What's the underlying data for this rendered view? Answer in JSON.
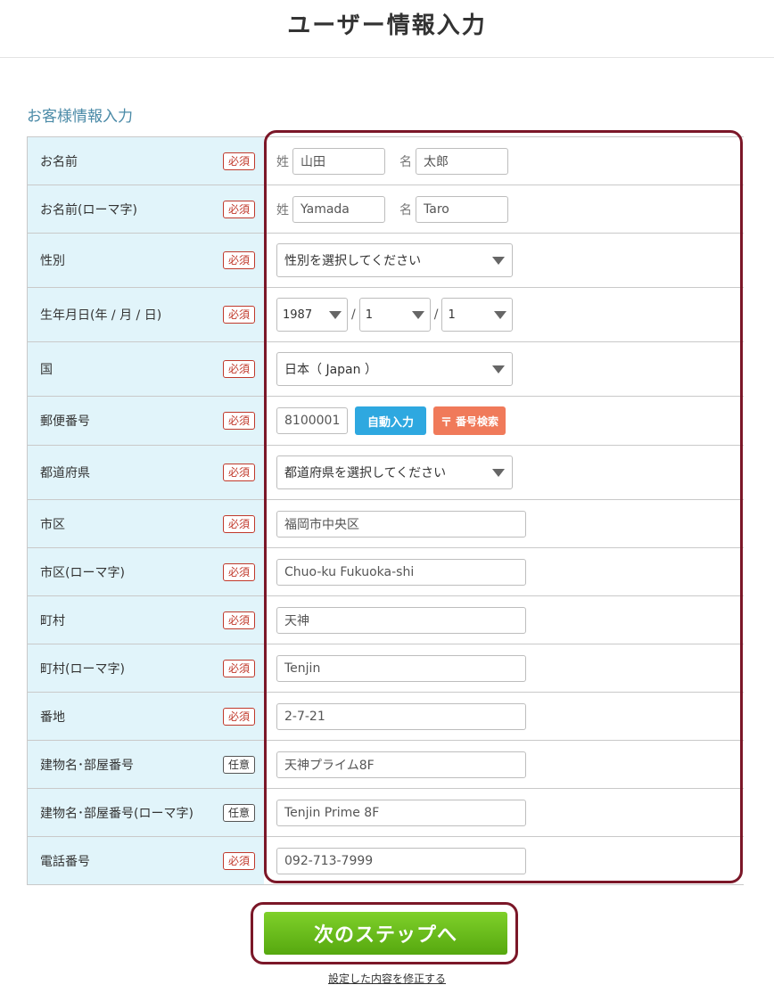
{
  "header": {
    "title": "ユーザー情報入力"
  },
  "section": {
    "title": "お客様情報入力"
  },
  "badges": {
    "required": "必須",
    "optional": "任意"
  },
  "fields": {
    "name": {
      "label": "お名前",
      "last_prefix": "姓",
      "last_value": "山田",
      "first_prefix": "名",
      "first_value": "太郎"
    },
    "name_roman": {
      "label": "お名前(ローマ字)",
      "last_prefix": "姓",
      "last_value": "Yamada",
      "first_prefix": "名",
      "first_value": "Taro"
    },
    "gender": {
      "label": "性別",
      "value": "性別を選択してください"
    },
    "birthdate": {
      "label": "生年月日(年 / 月 / 日)",
      "year": "1987",
      "month": "1",
      "day": "1",
      "separator": "/"
    },
    "country": {
      "label": "国",
      "value": "日本（ Japan ）"
    },
    "postal": {
      "label": "郵便番号",
      "value": "8100001",
      "auto_button": "自動入力",
      "search_button": "番号検索",
      "search_icon": "〒"
    },
    "prefecture": {
      "label": "都道府県",
      "value": "都道府県を選択してください"
    },
    "city": {
      "label": "市区",
      "value": "福岡市中央区"
    },
    "city_roman": {
      "label": "市区(ローマ字)",
      "value": "Chuo-ku Fukuoka-shi"
    },
    "town": {
      "label": "町村",
      "value": "天神"
    },
    "town_roman": {
      "label": "町村(ローマ字)",
      "value": "Tenjin"
    },
    "address": {
      "label": "番地",
      "value": "2-7-21"
    },
    "building": {
      "label": "建物名･部屋番号",
      "value": "天神プライム8F"
    },
    "building_roman": {
      "label": "建物名･部屋番号(ローマ字)",
      "value": "Tenjin Prime 8F"
    },
    "phone": {
      "label": "電話番号",
      "value": "092-713-7999"
    }
  },
  "actions": {
    "next_label": "次のステップへ",
    "modify_label": "設定した内容を修正する"
  },
  "colors": {
    "accent_blue": "#2ea8e0",
    "search_orange": "#f07a5a",
    "next_green": "#6bbf1e",
    "highlight": "#7b1728",
    "label_bg": "#e1f4fa"
  }
}
